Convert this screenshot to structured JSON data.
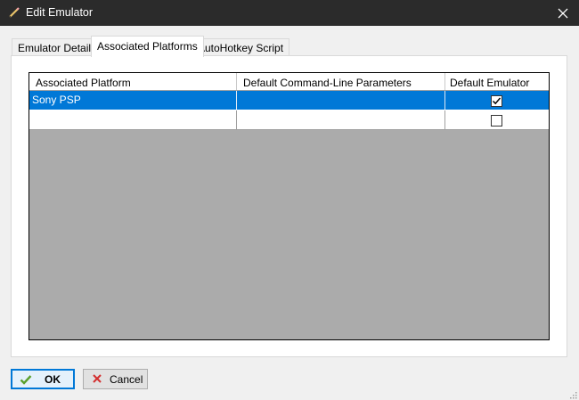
{
  "window": {
    "title": "Edit Emulator"
  },
  "tabs": [
    {
      "label": "Emulator Details",
      "active": false
    },
    {
      "label": "Associated Platforms",
      "active": true
    },
    {
      "label": "AutoHotkey Script",
      "active": false
    }
  ],
  "grid": {
    "columns": [
      "Associated Platform",
      "Default Command-Line Parameters",
      "Default Emulator"
    ],
    "rows": [
      {
        "platform": "Sony PSP",
        "params": "",
        "default_emulator": true,
        "selected": true
      },
      {
        "platform": "",
        "params": "",
        "default_emulator": false,
        "selected": false
      }
    ]
  },
  "buttons": {
    "ok": "OK",
    "cancel": "Cancel"
  },
  "colors": {
    "titlebar": "#2b2b2b",
    "selection": "#0078d7",
    "grid_empty": "#ababab",
    "ok_icon": "#5aa02c",
    "cancel_icon": "#d32f2f"
  }
}
